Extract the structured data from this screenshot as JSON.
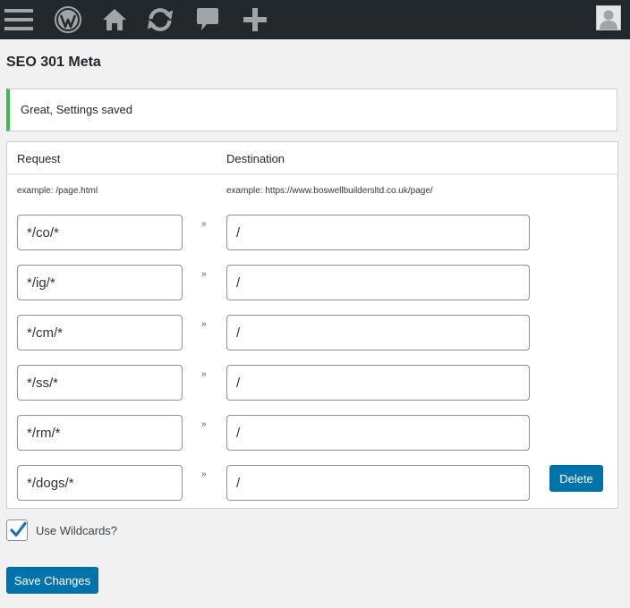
{
  "adminbar": {
    "icons": [
      "menu-icon",
      "wordpress-logo-icon",
      "home-icon",
      "updates-icon",
      "comments-icon",
      "add-new-icon"
    ],
    "avatar": "avatar"
  },
  "page": {
    "title": "SEO 301 Meta"
  },
  "notice": {
    "text": "Great, Settings saved",
    "color": "#46b450"
  },
  "table": {
    "headers": {
      "request": "Request",
      "destination": "Destination"
    },
    "examples": {
      "request": "example: /page.html",
      "destination": "example: https://www.boswellbuildersltd.co.uk/page/"
    },
    "separator": "»",
    "rows": [
      {
        "request": "*/co/*",
        "destination": "/"
      },
      {
        "request": "*/ig/*",
        "destination": "/"
      },
      {
        "request": "*/cm/*",
        "destination": "/"
      },
      {
        "request": "*/ss/*",
        "destination": "/"
      },
      {
        "request": "*/rm/*",
        "destination": "/"
      },
      {
        "request": "*/dogs/*",
        "destination": "/"
      }
    ],
    "delete_label": "Delete"
  },
  "options": {
    "wildcards_label": "Use Wildcards?",
    "wildcards_checked": true
  },
  "actions": {
    "save_label": "Save Changes"
  },
  "colors": {
    "accent": "#0073aa",
    "adminbar": "#23282d"
  }
}
